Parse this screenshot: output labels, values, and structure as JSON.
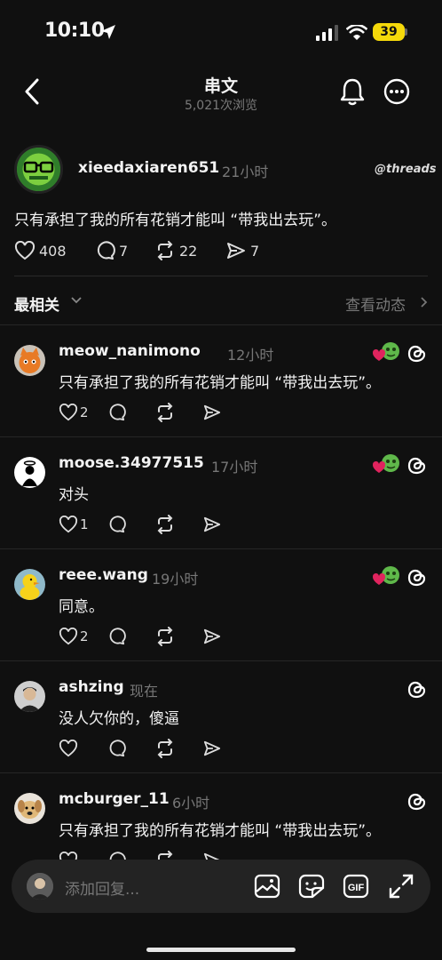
{
  "status_bar": {
    "time": "10:10",
    "battery": "39"
  },
  "header": {
    "title": "串文",
    "views": "5,021次浏览"
  },
  "post": {
    "author": "xieedaxiaren651",
    "time": "21小时",
    "brand": "threads",
    "text": "只有承担了我的所有花销才能叫 “带我出去玩”。",
    "likes": "408",
    "comments": "7",
    "reposts": "22",
    "shares": "7"
  },
  "sort": {
    "label": "最相关",
    "view_activity": "查看动态"
  },
  "replies": [
    {
      "user": "meow_nanimono",
      "time": "12小时",
      "text": "只有承担了我的所有花销才能叫 “带我出去玩”。",
      "likes": "2",
      "badge": true
    },
    {
      "user": "moose.34977515",
      "time": "17小时",
      "text": "对头",
      "likes": "1",
      "badge": true
    },
    {
      "user": "reee.wang",
      "time": "19小时",
      "text": "同意。",
      "likes": "2",
      "badge": true
    },
    {
      "user": "ashzing",
      "time": "现在",
      "text": "没人欠你的，傻逼",
      "likes": "",
      "badge": false
    },
    {
      "user": "mcburger_11",
      "time": "6小时",
      "text": "只有承担了我的所有花销才能叫 “带我出去玩”。",
      "likes": "",
      "badge": false
    }
  ],
  "reply_box": {
    "placeholder": "添加回复..."
  },
  "colors": {
    "background": "#101010",
    "text": "#f3f3f3",
    "muted": "#777777",
    "heart_red": "#e0245e",
    "badge_green": "#4caf50"
  }
}
